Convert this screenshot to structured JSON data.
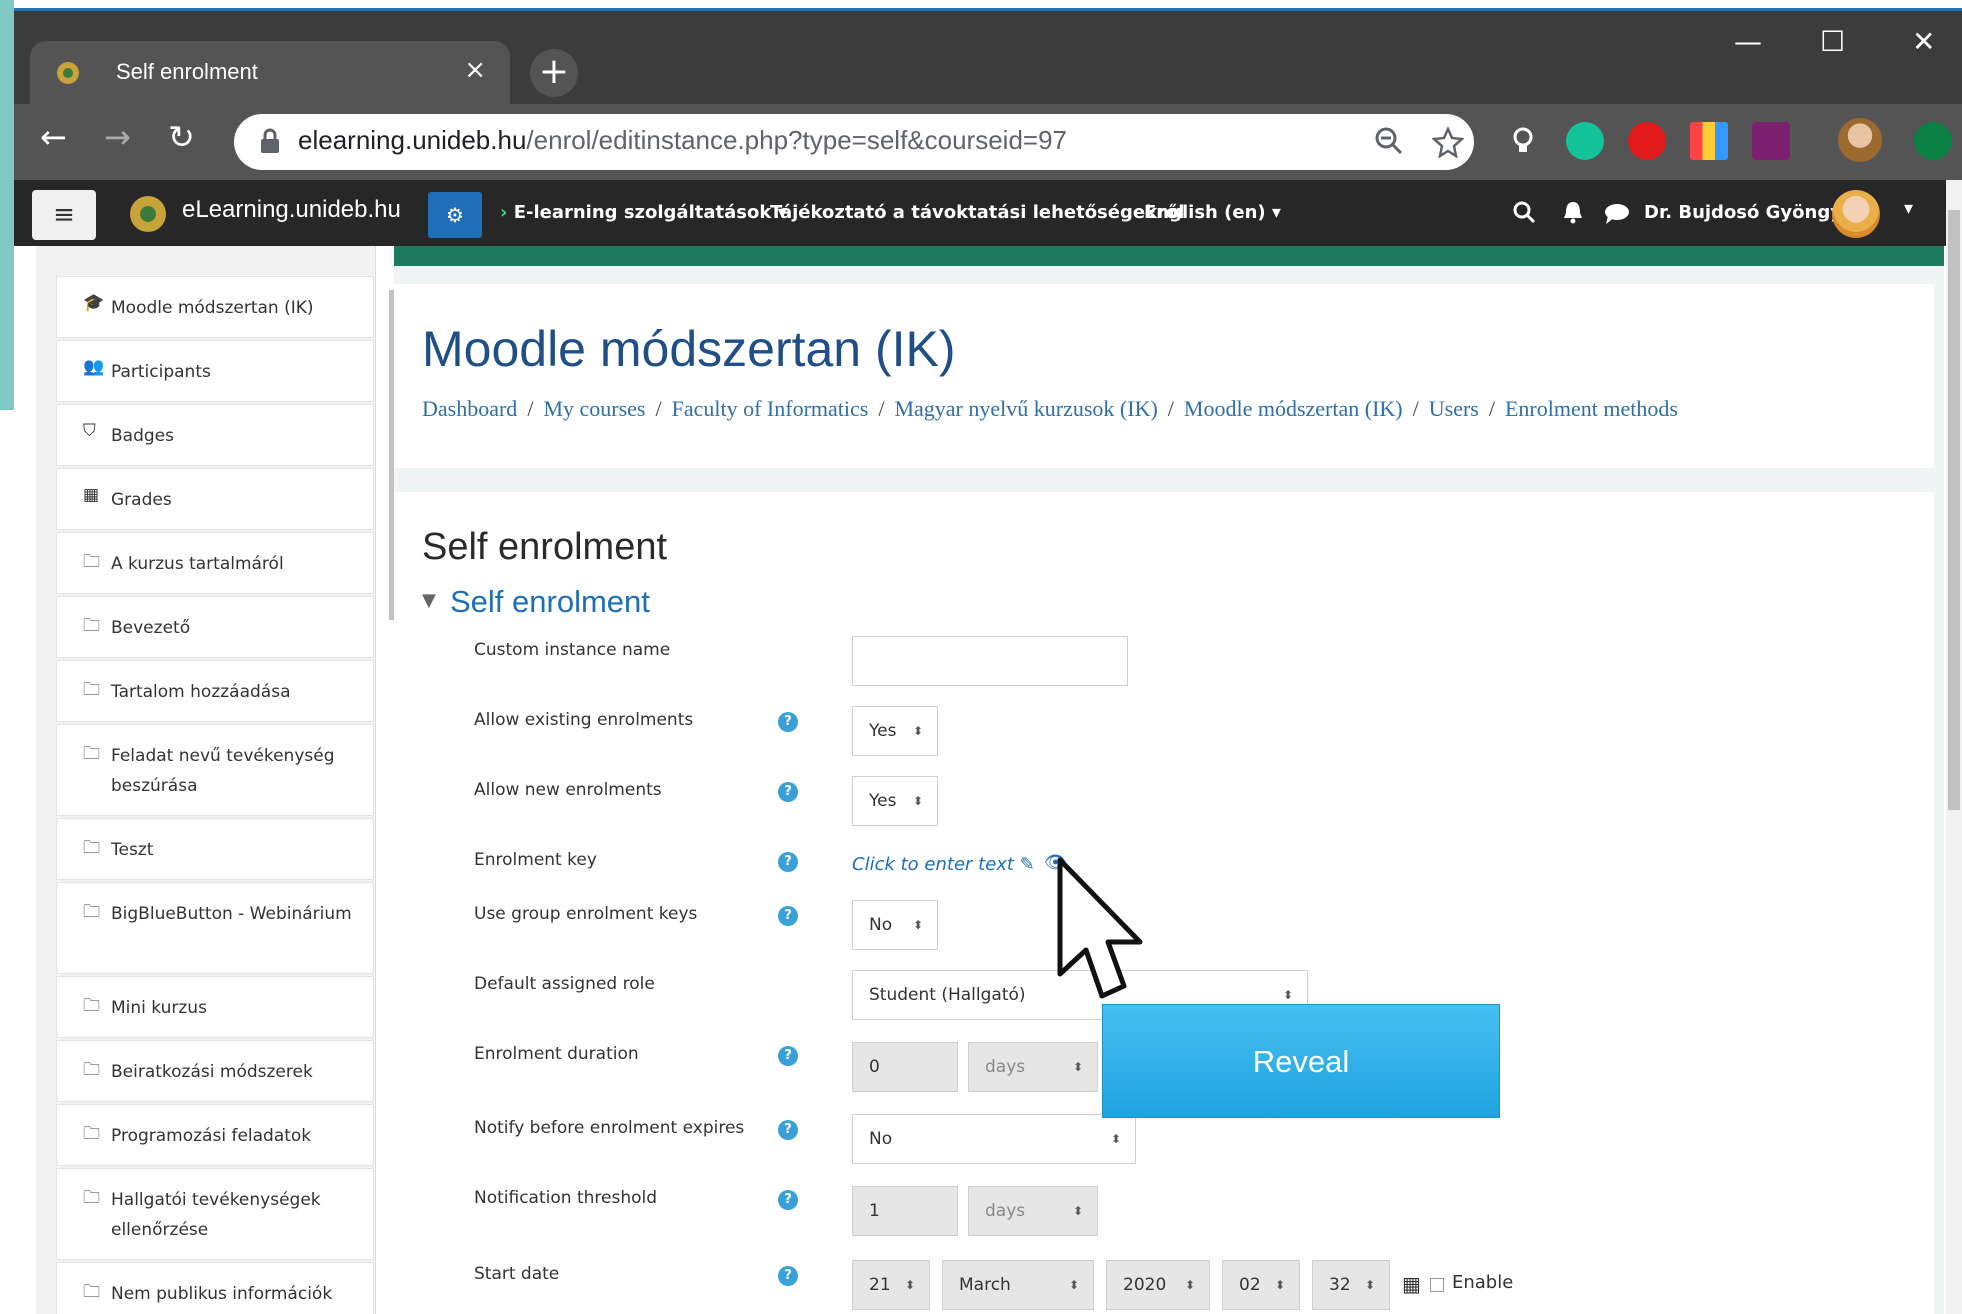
{
  "browser": {
    "tab_title": "Self enrolment",
    "tab_close": "×",
    "new_tab": "+",
    "url_host": "elearning.unideb.hu",
    "url_path": "/enrol/editinstance.php?type=self&courseid=97",
    "window_controls": {
      "minimize": "—",
      "maximize": "☐",
      "close": "✕"
    },
    "nav": {
      "back": "←",
      "forward": "→",
      "reload": "↻"
    },
    "extensions": [
      "bulb-icon",
      "grammarly-icon",
      "adblock-icon",
      "color-grid-icon",
      "office-icon",
      "profile-avatar-icon",
      "update-arrow-icon"
    ]
  },
  "navbar": {
    "site_name": "eLearning.unideb.hu",
    "menu_elearning": "E-learning szolgáltatások",
    "menu_info": "Tájékoztató a távoktatási lehetőségekről",
    "menu_language": "English (en)",
    "user_name": "Dr. Bujdosó Gyöngyi"
  },
  "drawer": {
    "items": [
      {
        "icon": "graduation-cap-icon",
        "label": "Moodle módszertan (IK)"
      },
      {
        "icon": "users-icon",
        "label": "Participants"
      },
      {
        "icon": "shield-icon",
        "label": "Badges"
      },
      {
        "icon": "table-icon",
        "label": "Grades"
      },
      {
        "icon": "folder-icon",
        "label": "A kurzus tartalmáról"
      },
      {
        "icon": "folder-icon",
        "label": "Bevezető"
      },
      {
        "icon": "folder-icon",
        "label": "Tartalom hozzáadása"
      },
      {
        "icon": "folder-icon",
        "label": "Feladat nevű tevékenység beszúrása"
      },
      {
        "icon": "folder-icon",
        "label": "Teszt"
      },
      {
        "icon": "folder-icon",
        "label": "BigBlueButton - Webinárium"
      },
      {
        "icon": "folder-icon",
        "label": "Mini kurzus"
      },
      {
        "icon": "folder-icon",
        "label": "Beiratkozási módszerek"
      },
      {
        "icon": "folder-icon",
        "label": "Programozási feladatok"
      },
      {
        "icon": "folder-icon",
        "label": "Hallgatói tevékenységek ellenőrzése"
      },
      {
        "icon": "folder-icon",
        "label": "Nem publikus információk"
      }
    ]
  },
  "header": {
    "course_title": "Moodle módszertan (IK)",
    "breadcrumb": [
      "Dashboard",
      "My courses",
      "Faculty of Informatics",
      "Magyar nyelvű kurzusok (IK)",
      "Moodle módszertan (IK)",
      "Users",
      "Enrolment methods"
    ]
  },
  "form": {
    "page_heading": "Self enrolment",
    "section_heading": "Self enrolment",
    "custom_instance_name": {
      "label": "Custom instance name",
      "value": ""
    },
    "allow_existing": {
      "label": "Allow existing enrolments",
      "value": "Yes"
    },
    "allow_new": {
      "label": "Allow new enrolments",
      "value": "Yes"
    },
    "enrolment_key": {
      "label": "Enrolment key",
      "placeholder": "Click to enter text"
    },
    "group_keys": {
      "label": "Use group enrolment keys",
      "value": "No"
    },
    "default_role": {
      "label": "Default assigned role",
      "value": "Student (Hallgató)"
    },
    "enrolment_duration": {
      "label": "Enrolment duration",
      "value": "0",
      "unit": "days"
    },
    "notify_before": {
      "label": "Notify before enrolment expires",
      "value": "No"
    },
    "notification_threshold": {
      "label": "Notification threshold",
      "value": "1",
      "unit": "days"
    },
    "start_date": {
      "label": "Start date",
      "day": "21",
      "month": "March",
      "year": "2020",
      "hour": "02",
      "minute": "32",
      "enable_label": "Enable"
    },
    "help_glyph": "?"
  },
  "overlay": {
    "reveal_label": "Reveal"
  },
  "colors": {
    "accent": "#1f6eb8",
    "navbar": "#272727",
    "reveal": "#1fa3df",
    "teal_bar": "#1d7a5c"
  }
}
